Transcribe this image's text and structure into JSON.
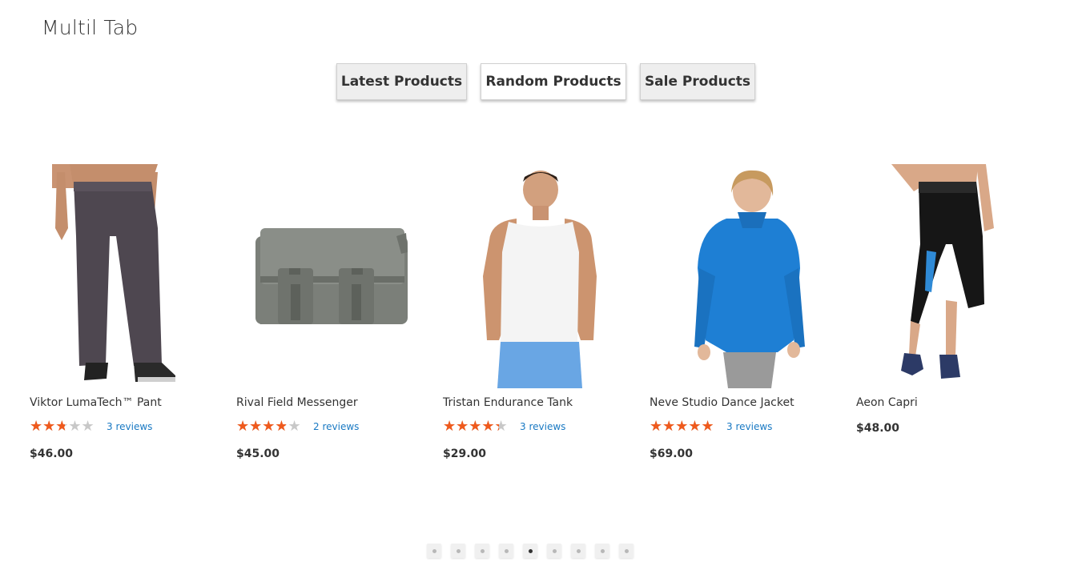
{
  "block": {
    "title": "Multil Tab"
  },
  "tabs": [
    {
      "label": "Latest Products",
      "active": false
    },
    {
      "label": "Random Products",
      "active": true
    },
    {
      "label": "Sale Products",
      "active": false
    }
  ],
  "products": [
    {
      "name": "Viktor LumaTech™ Pant",
      "rating_stars": 2.5,
      "reviews": "3 reviews",
      "price": "$46.00",
      "image": "men-pants"
    },
    {
      "name": "Rival Field Messenger",
      "rating_stars": 3.5,
      "reviews": "2 reviews",
      "price": "$45.00",
      "image": "messenger-bag"
    },
    {
      "name": "Tristan Endurance Tank",
      "rating_stars": 4,
      "reviews": "3 reviews",
      "price": "$29.00",
      "image": "men-tank"
    },
    {
      "name": "Neve Studio Dance Jacket",
      "rating_stars": 4.5,
      "reviews": "3 reviews",
      "price": "$69.00",
      "image": "women-jacket"
    },
    {
      "name": "Aeon Capri",
      "rating_stars": null,
      "reviews": "",
      "price": "$48.00",
      "image": "women-capri"
    }
  ],
  "pagination": {
    "count": 9,
    "active_index": 4
  },
  "colors": {
    "star_filled": "#ef5a1d",
    "star_empty": "#c8c8c8",
    "link": "#1979c3"
  }
}
